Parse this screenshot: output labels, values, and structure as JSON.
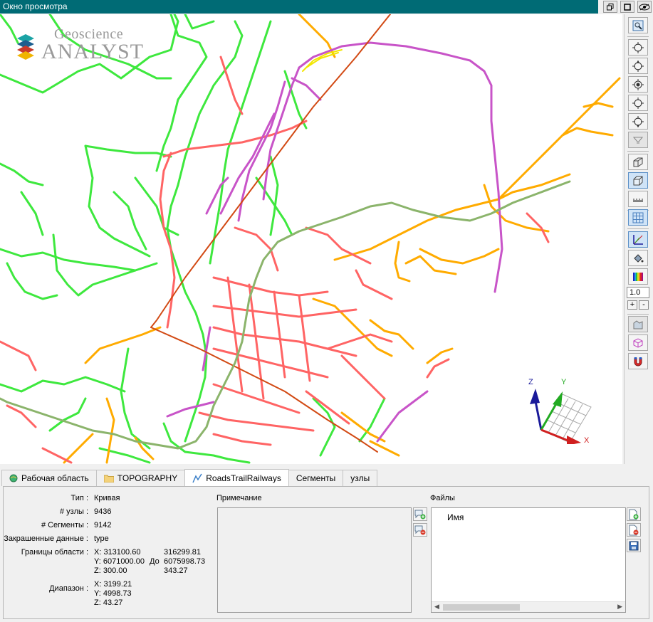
{
  "window": {
    "title": "Окно просмотра"
  },
  "logo": {
    "line1": "Geoscience",
    "line2": "ANALYST"
  },
  "axes": {
    "x": "X",
    "y": "Y",
    "z": "Z"
  },
  "toolbar": {
    "scale_value": "1.0",
    "plus": "+",
    "minus": "-"
  },
  "tabs": [
    {
      "label": "Рабочая область",
      "icon": "workspace-globe-icon"
    },
    {
      "label": "TOPOGRAPHY",
      "icon": "folder-icon"
    },
    {
      "label": "RoadsTrailRailways",
      "icon": "curve-icon",
      "active": true
    },
    {
      "label": "Сегменты"
    },
    {
      "label": "узлы"
    }
  ],
  "properties": {
    "type_label": "Тип :",
    "type_value": "Кривая",
    "nodes_label": "# узлы :",
    "nodes_value": "9436",
    "segments_label": "# Сегменты :",
    "segments_value": "9142",
    "colored_label": "Закрашенные данные :",
    "colored_value": "type",
    "bounds_label": "Границы области :",
    "bounds": {
      "x_min": "X: 313100.60",
      "y_min": "Y: 6071000.00",
      "z_min": "Z: 300.00",
      "to": "До",
      "x_max": "316299.81",
      "y_max": "6075998.73",
      "z_max": "343.27"
    },
    "range_label": "Диапазон :",
    "range": {
      "x": "X: 3199.21",
      "y": "Y: 4998.73",
      "z": "Z: 43.27"
    }
  },
  "notes": {
    "label": "Примечание"
  },
  "files": {
    "label": "Файлы",
    "column": "Имя"
  }
}
